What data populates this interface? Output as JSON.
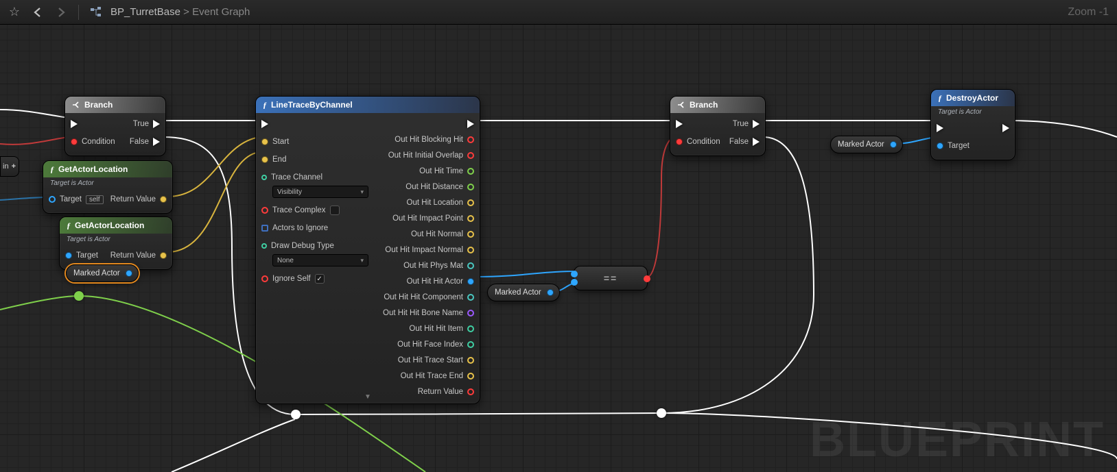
{
  "toolbar": {
    "breadcrumb_root": "BP_TurretBase",
    "breadcrumb_leaf": "Event Graph",
    "zoom_label": "Zoom -1"
  },
  "watermark": "BLUEPRINT",
  "fragment": {
    "pin_label": "in",
    "plus": "+"
  },
  "branch1": {
    "title": "Branch",
    "true": "True",
    "false": "False",
    "condition": "Condition"
  },
  "gal1": {
    "title": "GetActorLocation",
    "subtitle": "Target is Actor",
    "target": "Target",
    "self": "self",
    "return": "Return Value"
  },
  "gal2": {
    "title": "GetActorLocation",
    "subtitle": "Target is Actor",
    "target": "Target",
    "return": "Return Value"
  },
  "marked1": {
    "label": "Marked Actor"
  },
  "marked2": {
    "label": "Marked Actor"
  },
  "marked3": {
    "label": "Marked Actor"
  },
  "linetrace": {
    "title": "LineTraceByChannel",
    "start": "Start",
    "end": "End",
    "trace_channel": "Trace Channel",
    "trace_channel_value": "Visibility",
    "trace_complex": "Trace Complex",
    "actors_ignore": "Actors to Ignore",
    "draw_debug": "Draw Debug Type",
    "draw_debug_value": "None",
    "ignore_self": "Ignore Self",
    "out_blocking": "Out Hit Blocking Hit",
    "out_initial": "Out Hit Initial Overlap",
    "out_time": "Out Hit Time",
    "out_distance": "Out Hit Distance",
    "out_location": "Out Hit Location",
    "out_impact_point": "Out Hit Impact Point",
    "out_normal": "Out Hit Normal",
    "out_impact_normal": "Out Hit Impact Normal",
    "out_phys_mat": "Out Hit Phys Mat",
    "out_hit_actor": "Out Hit Hit Actor",
    "out_hit_component": "Out Hit Hit Component",
    "out_hit_bone": "Out Hit Hit Bone Name",
    "out_hit_item": "Out Hit Hit Item",
    "out_face_index": "Out Hit Face Index",
    "out_trace_start": "Out Hit Trace Start",
    "out_trace_end": "Out Hit Trace End",
    "return": "Return Value"
  },
  "equals": {
    "op": "=="
  },
  "branch2": {
    "title": "Branch",
    "true": "True",
    "false": "False",
    "condition": "Condition"
  },
  "destroy": {
    "title": "DestroyActor",
    "subtitle": "Target is Actor",
    "target": "Target"
  }
}
